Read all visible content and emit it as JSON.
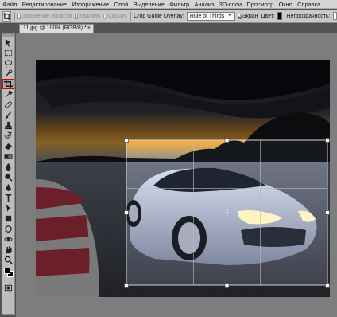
{
  "menu": [
    "Файл",
    "Редактирование",
    "Изображение",
    "Слой",
    "Выделение",
    "Фильтр",
    "Анализ",
    "3D-слои",
    "Просмотр",
    "Окно",
    "Справка"
  ],
  "options": {
    "shield_label": "Затенение области",
    "delete_label": "Удалить",
    "hide_label": "Скрыть",
    "overlay_label": "Crop Guide Overlay:",
    "overlay_value": "Rule of Thirds",
    "screen_label": "Экран",
    "color_label": "Цвет:",
    "opacity_label": "Непрозрачность:"
  },
  "document": {
    "tab_title": "11.jpg @ 100% (RGB/8) *",
    "close": "×"
  },
  "icons": {
    "crop_tool": "crop-icon",
    "tools": [
      "move-icon",
      "marquee-icon",
      "lasso-icon",
      "quick-select-icon",
      "crop-icon",
      "eyedropper-icon",
      "healing-icon",
      "brush-icon",
      "stamp-icon",
      "history-brush-icon",
      "eraser-icon",
      "gradient-icon",
      "blur-icon",
      "dodge-icon",
      "pen-icon",
      "type-icon",
      "path-select-icon",
      "shape-icon",
      "3d-rotate-icon",
      "3d-orbit-icon",
      "hand-icon",
      "zoom-icon"
    ]
  },
  "colors": {
    "foreground": "#000000",
    "background": "#000000",
    "active_tool_border": "#d60000",
    "shield": "#000000"
  }
}
